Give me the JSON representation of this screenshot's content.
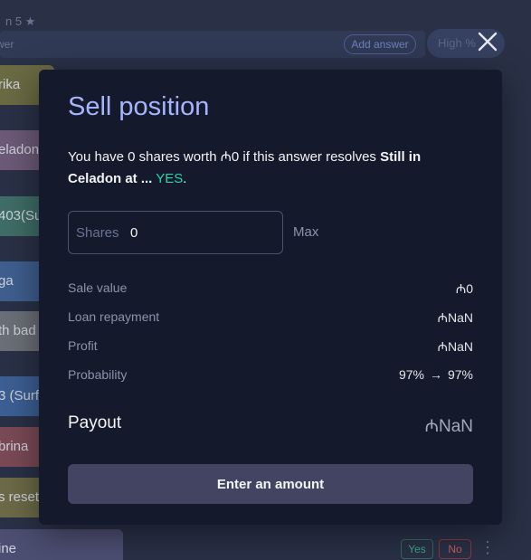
{
  "background": {
    "heading": "n 5 ★",
    "search_placeholder": "wer",
    "add_answer_label": "Add answer",
    "sort_label": "High %",
    "answers": [
      {
        "label": "rika",
        "color": "#6a6a43"
      },
      {
        "label": "eladon",
        "color": "#6c5a78"
      },
      {
        "label": "403(Su",
        "color": "#3f6d67"
      },
      {
        "label": "ga",
        "color": "#3f5f8f"
      },
      {
        "label": "th bad",
        "color": "#6b6f77"
      },
      {
        "label": "3 (Surf",
        "color": "#3c5f94"
      },
      {
        "label": "brina",
        "color": "#7a4a56"
      },
      {
        "label": "s reset",
        "color": "#6c6a47"
      },
      {
        "label": "ine",
        "color": "#4c4f72"
      }
    ],
    "yes_label": "Yes",
    "no_label": "No",
    "more_label": "⋮"
  },
  "modal": {
    "title": "Sell position",
    "desc_prefix": "You have 0 shares worth ₼0 if this answer resolves ",
    "desc_answer": "Still in Celadon at ...",
    "desc_mid": " ",
    "desc_outcome": "YES",
    "desc_suffix": ".",
    "shares_label": "Shares",
    "shares_value": "0",
    "max_label": "Max",
    "sale_value_label": "Sale value",
    "sale_value": "₼0",
    "loan_label": "Loan repayment",
    "loan_value": "₼NaN",
    "profit_label": "Profit",
    "profit_value": "₼NaN",
    "probability_label": "Probability",
    "prob_before": "97%",
    "prob_arrow": "→",
    "prob_after": "97%",
    "payout_label": "Payout",
    "payout_value": "₼NaN",
    "submit_label": "Enter an amount"
  },
  "colors": {
    "title": "#a5b4fc",
    "yes": "#2dd4a7",
    "modal_bg": "#141a2b",
    "button_bg": "#434462"
  },
  "icons": {
    "close": "close-icon"
  }
}
